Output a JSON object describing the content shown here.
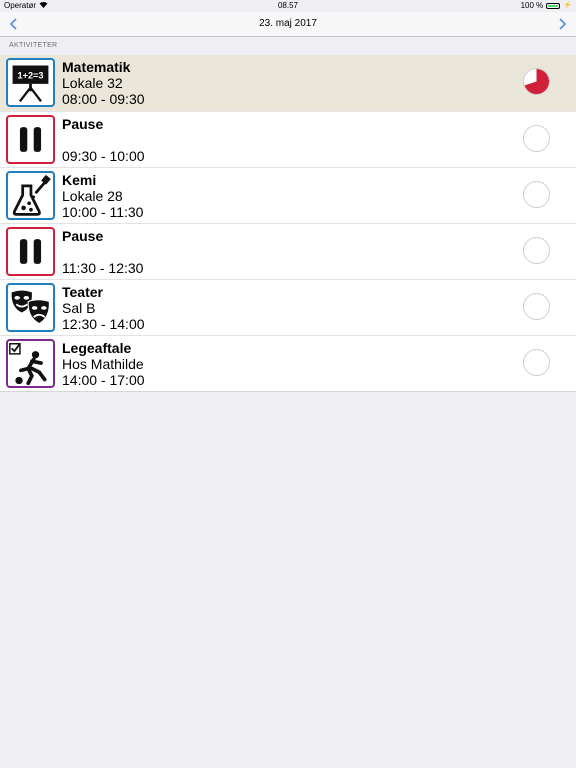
{
  "status": {
    "carrier": "Operatør",
    "time": "08.57",
    "battery": "100 %"
  },
  "nav": {
    "title": "23. maj 2017",
    "prev_icon": "chevron-left-icon",
    "next_icon": "chevron-right-icon"
  },
  "section": {
    "label": "AKTIVITETER"
  },
  "activities": [
    {
      "title": "Matematik",
      "place": "Lokale 32",
      "time": "08:00 - 09:30",
      "icon": "math-board-icon",
      "border": "#1f7fc0",
      "progress": 0.7,
      "active": true
    },
    {
      "title": "Pause",
      "place": "",
      "time": "09:30 - 10:00",
      "icon": "pause-icon",
      "border": "#d0203a",
      "progress": 0,
      "active": false
    },
    {
      "title": "Kemi",
      "place": "Lokale 28",
      "time": "10:00 - 11:30",
      "icon": "flask-icon",
      "border": "#1f7fc0",
      "progress": 0,
      "active": false
    },
    {
      "title": "Pause",
      "place": "",
      "time": "11:30 - 12:30",
      "icon": "pause-icon",
      "border": "#d0203a",
      "progress": 0,
      "active": false
    },
    {
      "title": "Teater",
      "place": "Sal B",
      "time": "12:30 - 14:00",
      "icon": "theater-masks-icon",
      "border": "#1f7fc0",
      "progress": 0,
      "active": false
    },
    {
      "title": "Legeaftale",
      "place": "Hos Mathilde",
      "time": "14:00 - 17:00",
      "icon": "playdate-icon",
      "border": "#7b2a8e",
      "progress": 0,
      "active": false
    }
  ]
}
